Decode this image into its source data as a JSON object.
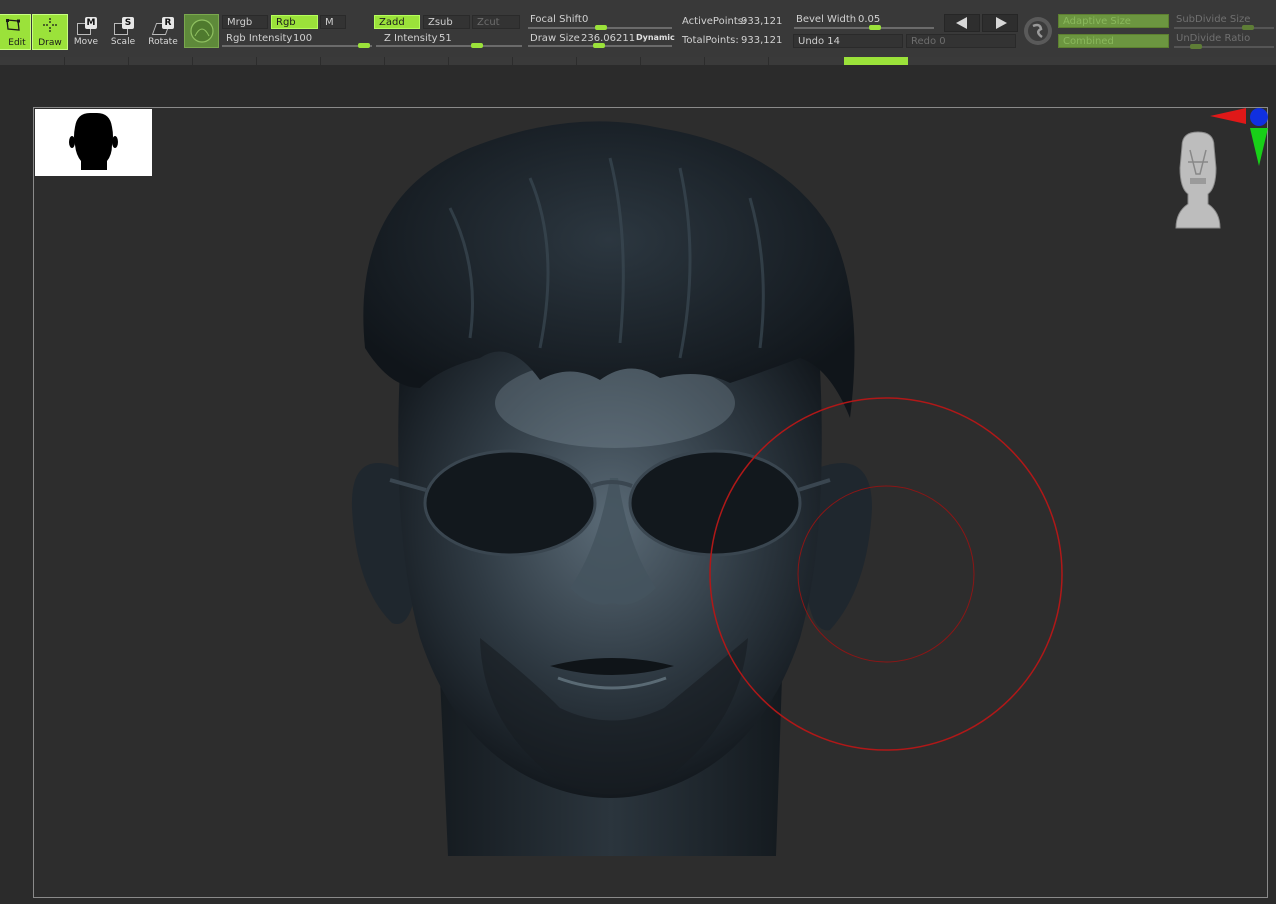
{
  "tools": [
    {
      "name": "edit",
      "label": "Edit",
      "active": true
    },
    {
      "name": "draw",
      "label": "Draw",
      "active": true
    },
    {
      "name": "move",
      "label": "Move",
      "key": "M",
      "active": false
    },
    {
      "name": "scale",
      "label": "Scale",
      "key": "S",
      "active": false
    },
    {
      "name": "rotate",
      "label": "Rotate",
      "key": "R",
      "active": false
    }
  ],
  "rgb_toggles": {
    "mrgb": "Mrgb",
    "rgb": "Rgb",
    "m": "M"
  },
  "rgb_intensity": {
    "label": "Rgb Intensity",
    "value": "100"
  },
  "z_toggles": {
    "zadd": "Zadd",
    "zsub": "Zsub",
    "zcut": "Zcut"
  },
  "z_intensity": {
    "label": "Z Intensity",
    "value": "51"
  },
  "focal_shift": {
    "label": "Focal Shift",
    "value": "0"
  },
  "draw_size": {
    "label": "Draw Size",
    "value": "236.06211",
    "dynamic": "Dynamic"
  },
  "stats": {
    "active_points_label": "ActivePoints:",
    "active_points": "933,121",
    "total_points_label": "TotalPoints:",
    "total_points": "933,121"
  },
  "bevel_width": {
    "label": "Bevel Width",
    "value": "0.05"
  },
  "undo": {
    "undo_label": "Undo 14",
    "redo_label": "Redo 0"
  },
  "right_panel": {
    "adaptive_size": "Adaptive Size",
    "combined": "Combined",
    "subdivide_size": "SubDivide Size",
    "undivide_ratio": "UnDivide Ratio"
  },
  "icons": {
    "material": "material-sphere-icon",
    "brush": "brush-alpha-icon",
    "nav_prev": "triangle-left-icon",
    "nav_next": "triangle-right-icon",
    "axis_gizmo": "axis-gizmo-icon",
    "head_preview": "head-navigation-icon"
  },
  "colors": {
    "accent": "#9be23a",
    "brush_cursor": "#b01818",
    "axis_x": "#e01818",
    "axis_y": "#18d018",
    "axis_z": "#1030e0"
  }
}
